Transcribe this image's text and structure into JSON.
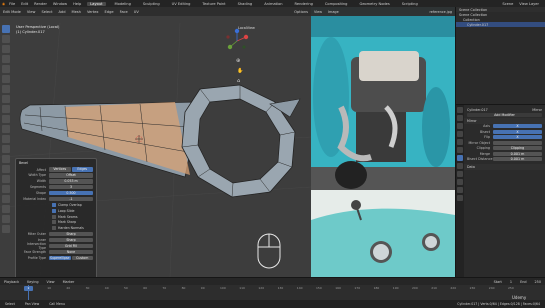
{
  "topbar": {
    "menus": [
      "File",
      "Edit",
      "Render",
      "Window",
      "Help"
    ],
    "workspaces": [
      "Layout",
      "Modeling",
      "Sculpting",
      "UV Editing",
      "Texture Paint",
      "Shading",
      "Animation",
      "Rendering",
      "Compositing",
      "Geometry Nodes",
      "Scripting"
    ],
    "active_workspace": "Layout",
    "scene_label": "Scene",
    "viewlayer_label": "View Layer"
  },
  "viewport": {
    "mode": "Edit Mode",
    "menus": [
      "View",
      "Select",
      "Add",
      "Mesh",
      "Vertex",
      "Edge",
      "Face",
      "UV"
    ],
    "options_label": "Options",
    "view_name": "User Perspective (Local)",
    "object_name": "(1) Cylinder.017",
    "localview_label": "LocalView"
  },
  "operator_panel": {
    "title": "Bevel",
    "rows": [
      {
        "label": "Affect",
        "type": "seg",
        "options": [
          "Vertices",
          "Edges"
        ],
        "selected": 1
      },
      {
        "label": "Width Type",
        "type": "field",
        "value": "Offset"
      },
      {
        "label": "Width",
        "type": "field",
        "value": "0.053 m"
      },
      {
        "label": "Segments",
        "type": "field",
        "value": "3"
      },
      {
        "label": "Shape",
        "type": "field",
        "value": "0.500",
        "blue": true
      },
      {
        "label": "Material Index",
        "type": "field",
        "value": "-1"
      }
    ],
    "checkboxes": [
      {
        "label": "Clamp Overlap",
        "on": true
      },
      {
        "label": "Loop Slide",
        "on": true
      },
      {
        "label": "Mark Seams",
        "on": false
      },
      {
        "label": "Mark Sharp",
        "on": false
      },
      {
        "label": "Harden Normals",
        "on": false
      }
    ],
    "rows2": [
      {
        "label": "Miter Outer",
        "type": "field",
        "value": "Sharp"
      },
      {
        "label": "Inner",
        "type": "field",
        "value": "Sharp"
      },
      {
        "label": "Intersection Type",
        "type": "field",
        "value": "Grid Fill"
      },
      {
        "label": "Face Strength",
        "type": "field",
        "value": "None"
      },
      {
        "label": "Profile Type",
        "type": "seg",
        "options": [
          "Superellipse",
          "Custom"
        ],
        "selected": 0
      }
    ]
  },
  "image_editor": {
    "menus": [
      "View",
      "Image"
    ],
    "image_name": "reference.jpg"
  },
  "outliner": {
    "title": "Scene Collection",
    "items": [
      {
        "label": "Scene Collection",
        "selected": false
      },
      {
        "label": "Collection",
        "selected": false
      },
      {
        "label": "Cylinder.017",
        "selected": true
      }
    ]
  },
  "properties": {
    "object_name": "Cylinder.017",
    "modifier_name": "Mirror",
    "add_modifier_label": "Add Modifier",
    "mirror_label": "Mirror",
    "rows": [
      {
        "label": "Axis",
        "value": "X"
      },
      {
        "label": "Bisect",
        "value": "X"
      },
      {
        "label": "Flip",
        "value": "X"
      },
      {
        "label": "Mirror Object",
        "value": ""
      },
      {
        "label": "Clipping",
        "value": "Clipping"
      },
      {
        "label": "Merge",
        "value": "0.001 m"
      },
      {
        "label": "Bisect Distance",
        "value": "0.001 m"
      }
    ],
    "data_label": "Data"
  },
  "timeline": {
    "menus": [
      "Playback",
      "Keying",
      "View",
      "Marker"
    ],
    "current_frame": "1",
    "start_label": "Start",
    "start_value": "1",
    "end_label": "End",
    "end_value": "250",
    "ticks": [
      "0",
      "10",
      "20",
      "30",
      "40",
      "50",
      "60",
      "70",
      "80",
      "90",
      "100",
      "110",
      "120",
      "130",
      "140",
      "150",
      "160",
      "170",
      "180",
      "190",
      "200",
      "210",
      "220",
      "230",
      "240",
      "250"
    ]
  },
  "status": {
    "left": "Select",
    "mid": "Pan View",
    "mid2": "Call Menu",
    "right": "Cylinder.017 | Verts:0/64 | Edges:0/128 | Faces:0/64"
  },
  "watermark": "Udemy"
}
